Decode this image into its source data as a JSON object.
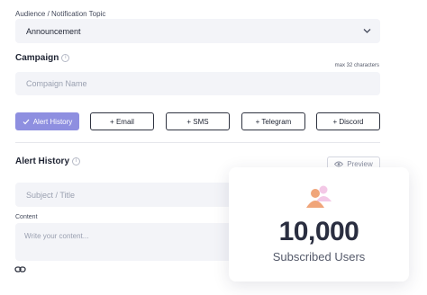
{
  "audience": {
    "label": "Audience / Notification Topic",
    "selected": "Announcement"
  },
  "campaign": {
    "title": "Campaign",
    "max_note": "max 32 characters",
    "placeholder": "Compaign Name"
  },
  "channels": {
    "active": "Alert History",
    "buttons": [
      "+ Email",
      "+ SMS",
      "+ Telegram",
      "+ Discord"
    ]
  },
  "alert_history": {
    "title": "Alert History",
    "preview_label": "Preview"
  },
  "subject": {
    "placeholder": "Subject / Title"
  },
  "content": {
    "label": "Content",
    "placeholder": "Write your content..."
  },
  "stat_card": {
    "value": "10,000",
    "caption": "Subscribed Users"
  },
  "colors": {
    "accent": "#8e8fe0",
    "users_orange": "#f0a57a",
    "users_pink": "#f3c8e6"
  }
}
